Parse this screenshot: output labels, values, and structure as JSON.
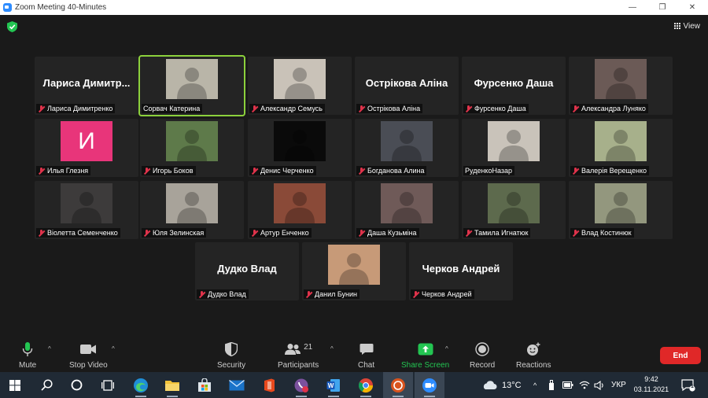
{
  "window": {
    "title": "Zoom Meeting 40-Minutes",
    "controls": [
      "—",
      "❐",
      "✕"
    ]
  },
  "view_label": "View",
  "tiles": [
    {
      "display": "Лариса  Димитр...",
      "name": "Лариса Димитренко",
      "muted": true,
      "video": false
    },
    {
      "display": "",
      "name": "Сорвач Катерина",
      "muted": false,
      "video": true,
      "active": true,
      "color": "#b9b5a8"
    },
    {
      "display": "",
      "name": "Александр Семусь",
      "muted": true,
      "video": true,
      "color": "#c9c2b8"
    },
    {
      "display": "Острікова Аліна",
      "name": "Острікова Аліна",
      "muted": true,
      "video": false
    },
    {
      "display": "Фурсенко Даша",
      "name": "Фурсенко Даша",
      "muted": true,
      "video": false
    },
    {
      "display": "",
      "name": "Александра Луняко",
      "muted": true,
      "video": true,
      "color": "#6b5a56"
    },
    {
      "display": "",
      "name": "Илья Глезня",
      "muted": true,
      "video": false,
      "avatar_letter": "И",
      "avatar_color": "#e8357a"
    },
    {
      "display": "",
      "name": "Игорь Боков",
      "muted": true,
      "video": true,
      "color": "#5e7a4a"
    },
    {
      "display": "",
      "name": "Денис Черченко",
      "muted": true,
      "video": true,
      "color": "#0a0a0a"
    },
    {
      "display": "",
      "name": "Богданова Алина",
      "muted": true,
      "video": true,
      "color": "#4a4d55"
    },
    {
      "display": "",
      "name": "РуденкоНазар",
      "muted": false,
      "video": true,
      "color": "#c9c3ba"
    },
    {
      "display": "",
      "name": "Валерія Верещенко",
      "muted": true,
      "video": true,
      "color": "#a7b08b"
    },
    {
      "display": "",
      "name": "Віолетта Семенченко",
      "muted": true,
      "video": true,
      "color": "#3d3b3b"
    },
    {
      "display": "",
      "name": "Юля Зелинская",
      "muted": true,
      "video": true,
      "color": "#a8a39a"
    },
    {
      "display": "",
      "name": "Артур Енченко",
      "muted": true,
      "video": true,
      "color": "#8a4a38"
    },
    {
      "display": "",
      "name": "Даша Кузьміна",
      "muted": true,
      "video": true,
      "color": "#6f5a58"
    },
    {
      "display": "",
      "name": "Тамила Игнатюк",
      "muted": true,
      "video": true,
      "color": "#5d6a4d"
    },
    {
      "display": "",
      "name": "Влад Костинюк",
      "muted": true,
      "video": true,
      "color": "#93977e"
    },
    {
      "display": "Дудко Влад",
      "name": "Дудко Влад",
      "muted": true,
      "video": false
    },
    {
      "display": "",
      "name": "Данил Бунин",
      "muted": true,
      "video": true,
      "color": "#c79a78"
    },
    {
      "display": "Черков Андрей",
      "name": "Черков Андрей",
      "muted": true,
      "video": false
    }
  ],
  "toolbar": {
    "mute": "Mute",
    "stop_video": "Stop Video",
    "security": "Security",
    "participants": "Participants",
    "participants_count": "21",
    "chat": "Chat",
    "share_screen": "Share Screen",
    "record": "Record",
    "reactions": "Reactions",
    "end": "End"
  },
  "taskbar": {
    "temperature": "13°C",
    "language": "УКР",
    "time": "9:42",
    "date": "03.11.2021",
    "notifications": "1"
  },
  "colors": {
    "accent_green": "#8cd13c",
    "share_green": "#23c552",
    "end_red": "#e02828",
    "mute_red": "#e0334b"
  }
}
